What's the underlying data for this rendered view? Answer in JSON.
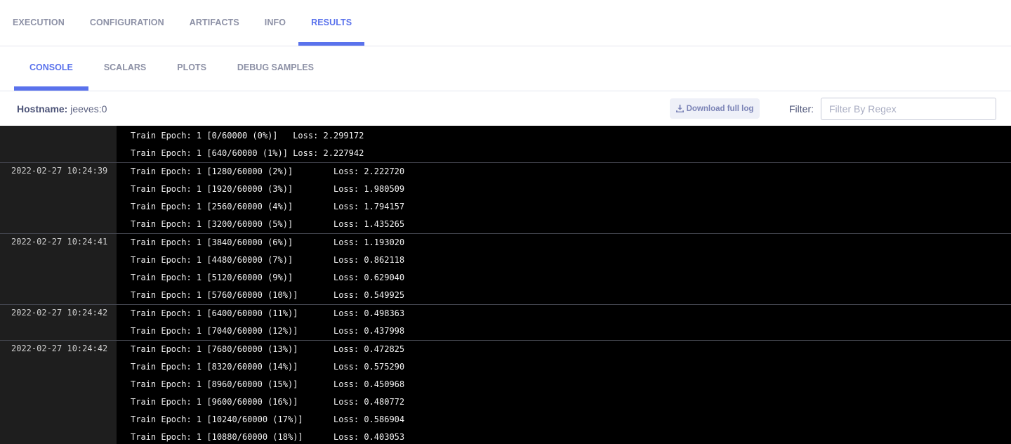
{
  "top_tabs": [
    {
      "label": "EXECUTION",
      "active": false
    },
    {
      "label": "CONFIGURATION",
      "active": false
    },
    {
      "label": "ARTIFACTS",
      "active": false
    },
    {
      "label": "INFO",
      "active": false
    },
    {
      "label": "RESULTS",
      "active": true
    }
  ],
  "sub_tabs": [
    {
      "label": "CONSOLE",
      "active": true
    },
    {
      "label": "SCALARS",
      "active": false
    },
    {
      "label": "PLOTS",
      "active": false
    },
    {
      "label": "DEBUG SAMPLES",
      "active": false
    }
  ],
  "toolbar": {
    "hostname_label": "Hostname:",
    "hostname_value": "jeeves:0",
    "download_label": "Download full log",
    "download_icon": "download-icon",
    "filter_label": "Filter:",
    "filter_placeholder": "Filter By Regex",
    "filter_value": ""
  },
  "colors": {
    "accent": "#5a72ec",
    "console_bg": "#000000",
    "timestamp_bg": "#1e1e1e"
  },
  "console": {
    "groups": [
      {
        "timestamp": "",
        "lines": [
          "Train Epoch: 1 [0/60000 (0%)]   Loss: 2.299172",
          "Train Epoch: 1 [640/60000 (1%)] Loss: 2.227942"
        ]
      },
      {
        "timestamp": "2022-02-27 10:24:39",
        "lines": [
          "Train Epoch: 1 [1280/60000 (2%)]\tLoss: 2.222720",
          "Train Epoch: 1 [1920/60000 (3%)]\tLoss: 1.980509",
          "Train Epoch: 1 [2560/60000 (4%)]\tLoss: 1.794157",
          "Train Epoch: 1 [3200/60000 (5%)]\tLoss: 1.435265"
        ]
      },
      {
        "timestamp": "2022-02-27 10:24:41",
        "lines": [
          "Train Epoch: 1 [3840/60000 (6%)]\tLoss: 1.193020",
          "Train Epoch: 1 [4480/60000 (7%)]\tLoss: 0.862118",
          "Train Epoch: 1 [5120/60000 (9%)]\tLoss: 0.629040",
          "Train Epoch: 1 [5760/60000 (10%)]\tLoss: 0.549925"
        ]
      },
      {
        "timestamp": "2022-02-27 10:24:42",
        "lines": [
          "Train Epoch: 1 [6400/60000 (11%)]\tLoss: 0.498363",
          "Train Epoch: 1 [7040/60000 (12%)]\tLoss: 0.437998"
        ]
      },
      {
        "timestamp": "2022-02-27 10:24:42",
        "lines": [
          "Train Epoch: 1 [7680/60000 (13%)]\tLoss: 0.472825",
          "Train Epoch: 1 [8320/60000 (14%)]\tLoss: 0.575290",
          "Train Epoch: 1 [8960/60000 (15%)]\tLoss: 0.450968",
          "Train Epoch: 1 [9600/60000 (16%)]\tLoss: 0.480772",
          "Train Epoch: 1 [10240/60000 (17%)]\tLoss: 0.586904",
          "Train Epoch: 1 [10880/60000 (18%)]\tLoss: 0.403053"
        ]
      }
    ]
  }
}
